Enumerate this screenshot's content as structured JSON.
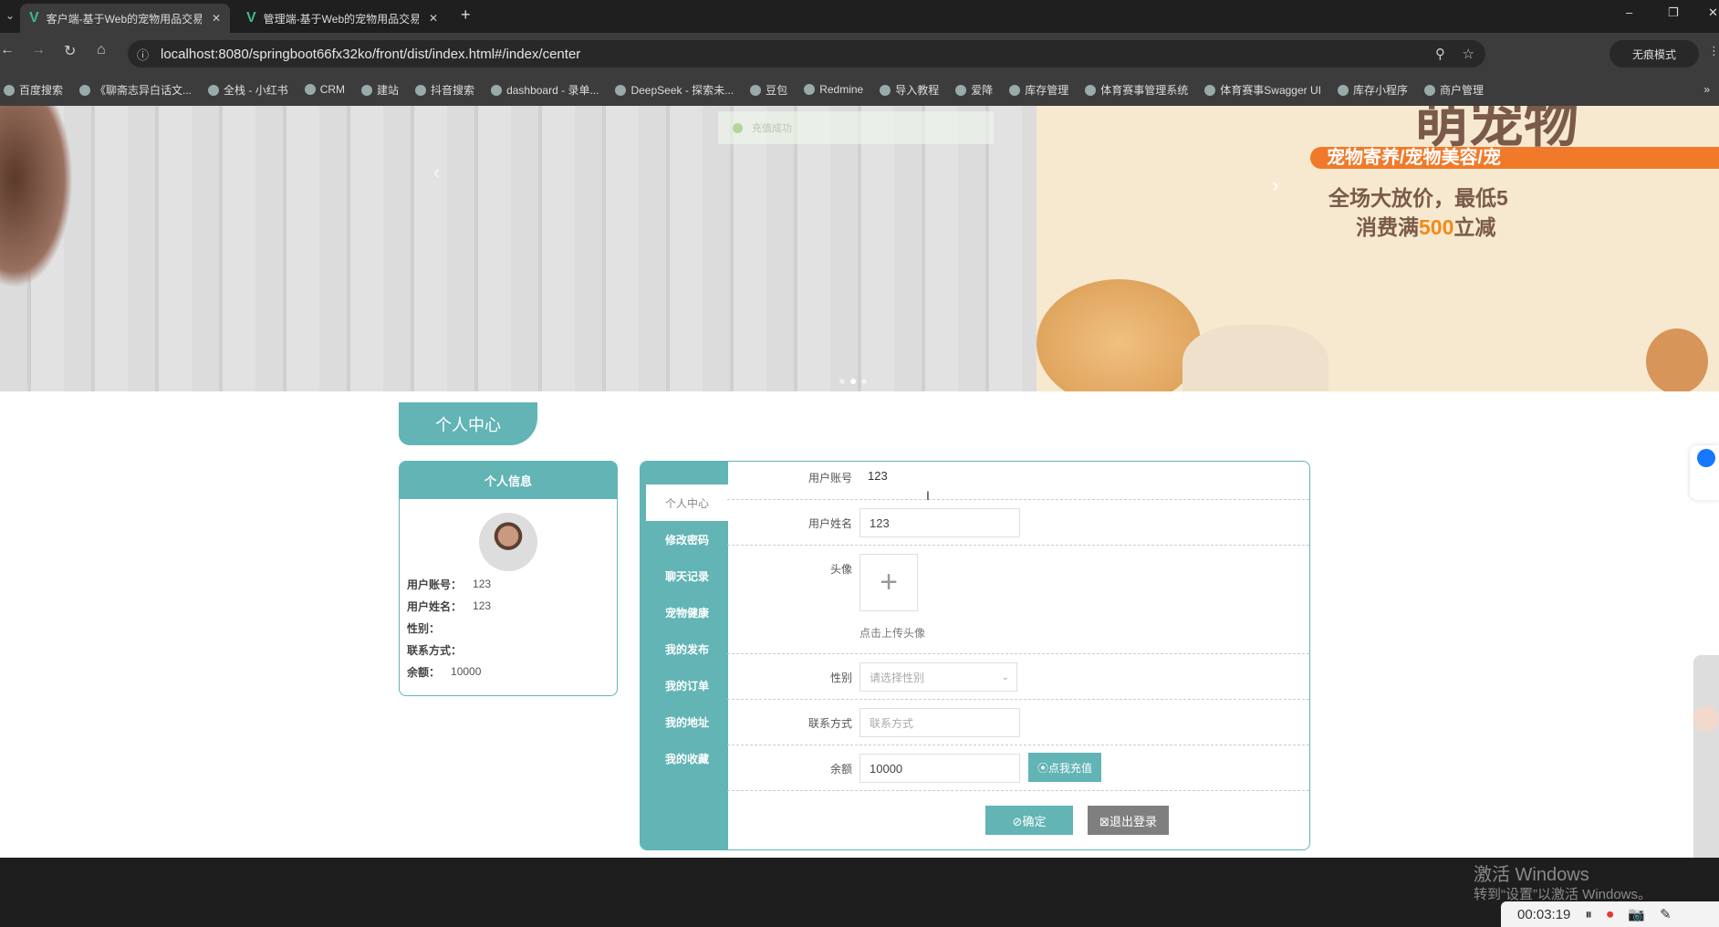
{
  "browser": {
    "tabs": [
      {
        "title": "客户端-基于Web的宠物用品交易",
        "active": true
      },
      {
        "title": "管理端-基于Web的宠物用品交易",
        "active": false
      }
    ],
    "url": "localhost:8080/springboot66fx32ko/front/dist/index.html#/index/center",
    "incognito_label": "无痕模式",
    "bookmarks": [
      "百度搜索",
      "《聊斋志异白话文...",
      "全栈 - 小红书",
      "CRM",
      "建站",
      "抖音搜索",
      "dashboard - 录单...",
      "DeepSeek - 探索未...",
      "豆包",
      "Redmine",
      "导入教程",
      "爱降",
      "库存管理",
      "体育赛事管理系统",
      "体育赛事Swagger UI",
      "库存小程序",
      "商户管理"
    ]
  },
  "banner": {
    "toast": "充值成功",
    "title": "萌宠物",
    "tagline": "宠物寄养/宠物美容/宠",
    "line1": "全场大放价，最低5",
    "line2_pre": "消费满",
    "line2_num": "500",
    "line2_post": "立减",
    "slide_count": 3,
    "active_slide": 1
  },
  "page": {
    "title": "个人中心",
    "info_card": {
      "header": "个人信息",
      "fields": [
        {
          "label": "用户账号：",
          "value": "123"
        },
        {
          "label": "用户姓名：",
          "value": "123"
        },
        {
          "label": "性别：",
          "value": ""
        },
        {
          "label": "联系方式：",
          "value": ""
        },
        {
          "label": "余额：",
          "value": "10000"
        }
      ]
    },
    "sidebar": [
      "个人中心",
      "修改密码",
      "聊天记录",
      "宠物健康",
      "我的发布",
      "我的订单",
      "我的地址",
      "我的收藏"
    ],
    "form": {
      "account_label": "用户账号",
      "account_value": "123",
      "name_label": "用户姓名",
      "name_value": "123",
      "avatar_label": "头像",
      "avatar_hint": "点击上传头像",
      "gender_label": "性别",
      "gender_placeholder": "请选择性别",
      "contact_label": "联系方式",
      "contact_placeholder": "联系方式",
      "balance_label": "余额",
      "balance_value": "10000",
      "recharge_button": "⦿点我充值",
      "confirm_button": "⊘确定",
      "logout_button": "⊠退出登录"
    }
  },
  "colors": {
    "accent": "#62b4b5",
    "logout": "#7f7f7f"
  },
  "overlay": {
    "watermark_title": "激活 Windows",
    "watermark_sub": "转到“设置”以激活 Windows。",
    "recorder_time": "00:03:19"
  }
}
